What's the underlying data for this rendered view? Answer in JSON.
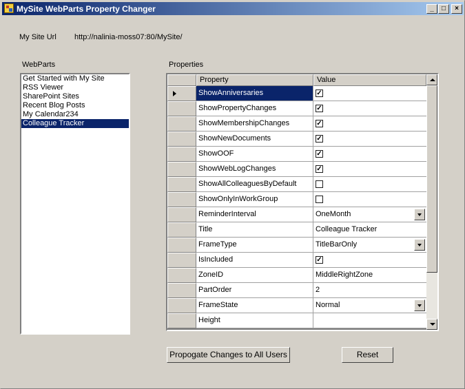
{
  "window": {
    "title": "MySite WebParts Property Changer",
    "icon": "app-icon",
    "buttons": {
      "minimize": "_",
      "maximize": "□",
      "close": "×"
    }
  },
  "mysite": {
    "label": "My Site Url",
    "url": "http://nalinia-moss07:80/MySite/"
  },
  "webparts": {
    "label": "WebParts",
    "items": [
      "Get Started with My Site",
      "RSS Viewer",
      "SharePoint Sites",
      "Recent Blog Posts",
      "My Calendar234",
      "Colleague Tracker"
    ],
    "selected_index": 5
  },
  "properties": {
    "label": "Properties",
    "columns": {
      "property": "Property",
      "value": "Value"
    },
    "rows": [
      {
        "property": "ShowAnniversaries",
        "type": "checkbox",
        "checked": true,
        "selected": true
      },
      {
        "property": "ShowPropertyChanges",
        "type": "checkbox",
        "checked": true
      },
      {
        "property": "ShowMembershipChanges",
        "type": "checkbox",
        "checked": true
      },
      {
        "property": "ShowNewDocuments",
        "type": "checkbox",
        "checked": true
      },
      {
        "property": "ShowOOF",
        "type": "checkbox",
        "checked": true
      },
      {
        "property": "ShowWebLogChanges",
        "type": "checkbox",
        "checked": true
      },
      {
        "property": "ShowAllColleaguesByDefault",
        "type": "checkbox",
        "checked": false
      },
      {
        "property": "ShowOnlyInWorkGroup",
        "type": "checkbox",
        "checked": false
      },
      {
        "property": "ReminderInterval",
        "type": "dropdown",
        "value": "OneMonth"
      },
      {
        "property": "Title",
        "type": "text",
        "value": "Colleague Tracker"
      },
      {
        "property": "FrameType",
        "type": "dropdown",
        "value": "TitleBarOnly"
      },
      {
        "property": "IsIncluded",
        "type": "checkbox",
        "checked": true
      },
      {
        "property": "ZoneID",
        "type": "text",
        "value": "MiddleRightZone"
      },
      {
        "property": "PartOrder",
        "type": "text",
        "value": "2"
      },
      {
        "property": "FrameState",
        "type": "dropdown",
        "value": "Normal"
      },
      {
        "property": "Height",
        "type": "text",
        "value": ""
      }
    ]
  },
  "buttons": {
    "propagate": "Propogate Changes to All Users",
    "reset": "Reset"
  }
}
